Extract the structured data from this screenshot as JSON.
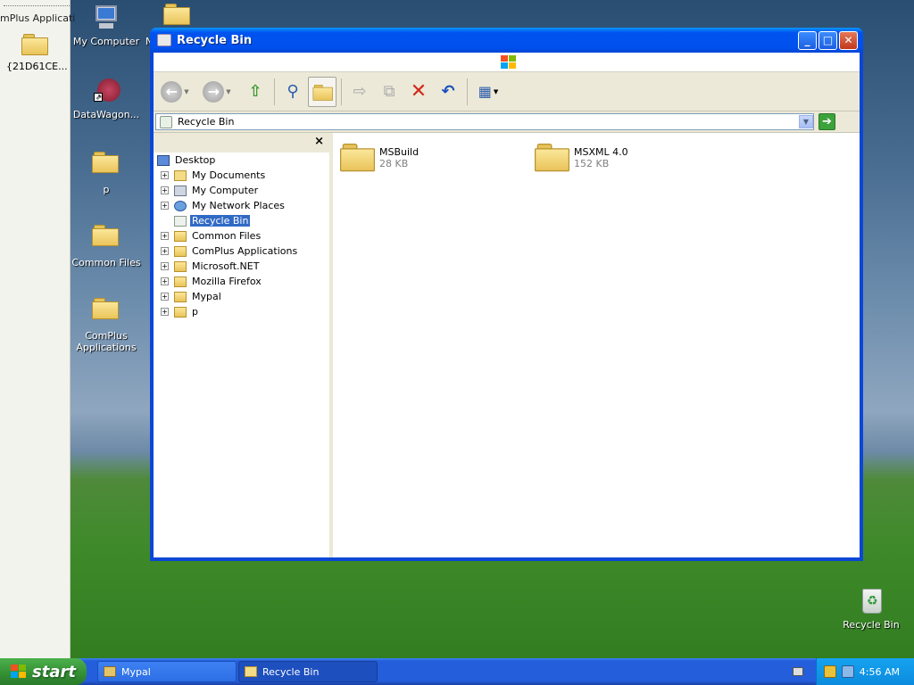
{
  "left_window": {
    "title_fragment": "mPlus Applicati",
    "icon_label": "{21D61CE..."
  },
  "desktop_icons": [
    {
      "label": "My Computer",
      "icon": "computer-icon"
    },
    {
      "label": "N",
      "icon": "folder-icon"
    },
    {
      "label": "DataWagon...",
      "icon": "datawagon-icon"
    },
    {
      "label": "p",
      "icon": "folder-icon"
    },
    {
      "label": "Common Files",
      "icon": "folder-icon"
    },
    {
      "label": "ComPlus Applications",
      "icon": "folder-icon"
    },
    {
      "label": "Recycle Bin",
      "icon": "recycle-bin-icon"
    }
  ],
  "window": {
    "title": "Recycle Bin",
    "address": "Recycle Bin",
    "controls": {
      "minimize": "_",
      "maximize": "□",
      "close": "✕"
    }
  },
  "toolbar": {
    "buttons": [
      "back",
      "forward",
      "up",
      "search",
      "folders",
      "move-to",
      "copy-to",
      "delete",
      "undo",
      "views"
    ]
  },
  "tree": {
    "close_glyph": "×",
    "nodes": [
      {
        "label": "Desktop",
        "level": 0,
        "expander": "",
        "icon": "desktop-icon"
      },
      {
        "label": "My Documents",
        "level": 1,
        "expander": "+",
        "icon": "my-documents-icon"
      },
      {
        "label": "My Computer",
        "level": 1,
        "expander": "+",
        "icon": "computer-icon"
      },
      {
        "label": "My Network Places",
        "level": 1,
        "expander": "+",
        "icon": "network-icon"
      },
      {
        "label": "Recycle Bin",
        "level": 1,
        "expander": "",
        "icon": "recycle-bin-icon",
        "selected": true
      },
      {
        "label": "Common Files",
        "level": 1,
        "expander": "+",
        "icon": "folder-icon"
      },
      {
        "label": "ComPlus Applications",
        "level": 1,
        "expander": "+",
        "icon": "folder-icon"
      },
      {
        "label": "Microsoft.NET",
        "level": 1,
        "expander": "+",
        "icon": "folder-icon"
      },
      {
        "label": "Mozilla Firefox",
        "level": 1,
        "expander": "+",
        "icon": "folder-icon"
      },
      {
        "label": "Mypal",
        "level": 1,
        "expander": "+",
        "icon": "folder-icon"
      },
      {
        "label": "p",
        "level": 1,
        "expander": "+",
        "icon": "folder-icon"
      }
    ]
  },
  "items": [
    {
      "name": "MSBuild",
      "size": "28 KB"
    },
    {
      "name": "MSXML 4.0",
      "size": "152 KB"
    }
  ],
  "taskbar": {
    "start_label": "start",
    "tasks": [
      {
        "label": "Mypal",
        "active": false
      },
      {
        "label": "Recycle Bin",
        "active": true
      }
    ],
    "clock": "4:56 AM"
  }
}
